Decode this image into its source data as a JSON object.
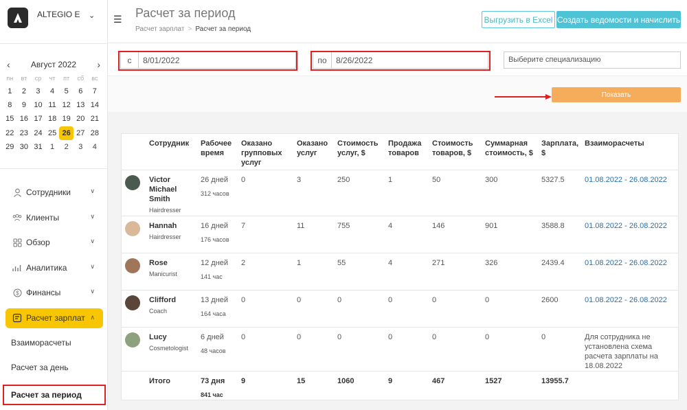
{
  "brand": {
    "name": "ALTEGIO E"
  },
  "calendar": {
    "month": "Август 2022",
    "weekdays": [
      "пн",
      "вт",
      "ср",
      "чт",
      "пт",
      "сб",
      "вс"
    ],
    "days": [
      [
        {
          "d": "1"
        },
        {
          "d": "2"
        },
        {
          "d": "3"
        },
        {
          "d": "4"
        },
        {
          "d": "5"
        },
        {
          "d": "6"
        },
        {
          "d": "7"
        }
      ],
      [
        {
          "d": "8"
        },
        {
          "d": "9"
        },
        {
          "d": "10"
        },
        {
          "d": "11"
        },
        {
          "d": "12"
        },
        {
          "d": "13"
        },
        {
          "d": "14"
        }
      ],
      [
        {
          "d": "15"
        },
        {
          "d": "16"
        },
        {
          "d": "17"
        },
        {
          "d": "18"
        },
        {
          "d": "19"
        },
        {
          "d": "20"
        },
        {
          "d": "21"
        }
      ],
      [
        {
          "d": "22"
        },
        {
          "d": "23"
        },
        {
          "d": "24"
        },
        {
          "d": "25"
        },
        {
          "d": "26",
          "selected": true
        },
        {
          "d": "27"
        },
        {
          "d": "28"
        }
      ],
      [
        {
          "d": "29"
        },
        {
          "d": "30"
        },
        {
          "d": "31"
        },
        {
          "d": "1",
          "other": true
        },
        {
          "d": "2",
          "other": true
        },
        {
          "d": "3",
          "other": true
        },
        {
          "d": "4",
          "other": true
        }
      ]
    ]
  },
  "nav": {
    "items": [
      {
        "label": "Сотрудники",
        "icon": "user-icon"
      },
      {
        "label": "Клиенты",
        "icon": "clients-icon"
      },
      {
        "label": "Обзор",
        "icon": "overview-icon"
      },
      {
        "label": "Аналитика",
        "icon": "analytics-icon"
      },
      {
        "label": "Финансы",
        "icon": "finance-icon"
      }
    ],
    "active": {
      "label": "Расчет зарплат",
      "icon": "payroll-icon"
    },
    "sub": [
      {
        "label": "Взаиморасчеты"
      },
      {
        "label": "Расчет за день"
      },
      {
        "label": "Расчет за период",
        "current": true
      }
    ]
  },
  "header": {
    "title": "Расчет за период",
    "breadcrumb": [
      "Расчет зарплат",
      "Расчет за период"
    ],
    "excel_label": "Выгрузить в Excel",
    "create_label": "Создать ведомости и начислить"
  },
  "filters": {
    "from_prefix": "с",
    "from_value": "8/01/2022",
    "to_prefix": "по",
    "to_value": "8/26/2022",
    "spec_placeholder": "Выберите специализацию",
    "show_label": "Показать"
  },
  "table": {
    "headers": [
      "Сотрудник",
      "Рабочее время",
      "Оказано групповых услуг",
      "Оказано услуг",
      "Стоимость услуг, $",
      "Продажа товаров",
      "Стоимость товаров, $",
      "Суммарная стоимость, $",
      "Зарплата, $",
      "Взаиморасчеты"
    ],
    "rows": [
      {
        "name": "Victor Michael Smith",
        "position": "Hairdresser",
        "days": "26 дней",
        "hours": "312 часов",
        "group": "0",
        "services": "3",
        "services_cost": "250",
        "goods": "1",
        "goods_cost": "50",
        "total_cost": "300",
        "salary": "5327.5",
        "settlement": "01.08.2022 - 26.08.2022",
        "avatar_color": "#4a5a4e"
      },
      {
        "name": "Hannah",
        "position": "Hairdresser",
        "days": "16 дней",
        "hours": "176 часов",
        "group": "7",
        "services": "11",
        "services_cost": "755",
        "goods": "4",
        "goods_cost": "146",
        "total_cost": "901",
        "salary": "3588.8",
        "settlement": "01.08.2022 - 26.08.2022",
        "avatar_color": "#d9b99a"
      },
      {
        "name": "Rose",
        "position": "Manicurist",
        "days": "12 дней",
        "hours": "141 час",
        "group": "2",
        "services": "1",
        "services_cost": "55",
        "goods": "4",
        "goods_cost": "271",
        "total_cost": "326",
        "salary": "2439.4",
        "settlement": "01.08.2022 - 26.08.2022",
        "avatar_color": "#a0765a"
      },
      {
        "name": "Clifford",
        "position": "Coach",
        "days": "13 дней",
        "hours": "164 часа",
        "group": "0",
        "services": "0",
        "services_cost": "0",
        "goods": "0",
        "goods_cost": "0",
        "total_cost": "0",
        "salary": "2600",
        "settlement": "01.08.2022 - 26.08.2022",
        "avatar_color": "#5a4638"
      },
      {
        "name": "Lucy",
        "position": "Cosmetologist",
        "days": "6 дней",
        "hours": "48 часов",
        "group": "0",
        "services": "0",
        "services_cost": "0",
        "goods": "0",
        "goods_cost": "0",
        "total_cost": "0",
        "salary": "0",
        "settlement": "Для сотрудника не установлена схема расчета зарплаты на 18.08.2022",
        "settlement_is_note": true,
        "avatar_color": "#8fa07e"
      }
    ],
    "total": {
      "label": "Итого",
      "days": "73 дня",
      "hours": "841 час",
      "group": "9",
      "services": "15",
      "services_cost": "1060",
      "goods": "9",
      "goods_cost": "467",
      "total_cost": "1527",
      "salary": "13955.7"
    }
  }
}
